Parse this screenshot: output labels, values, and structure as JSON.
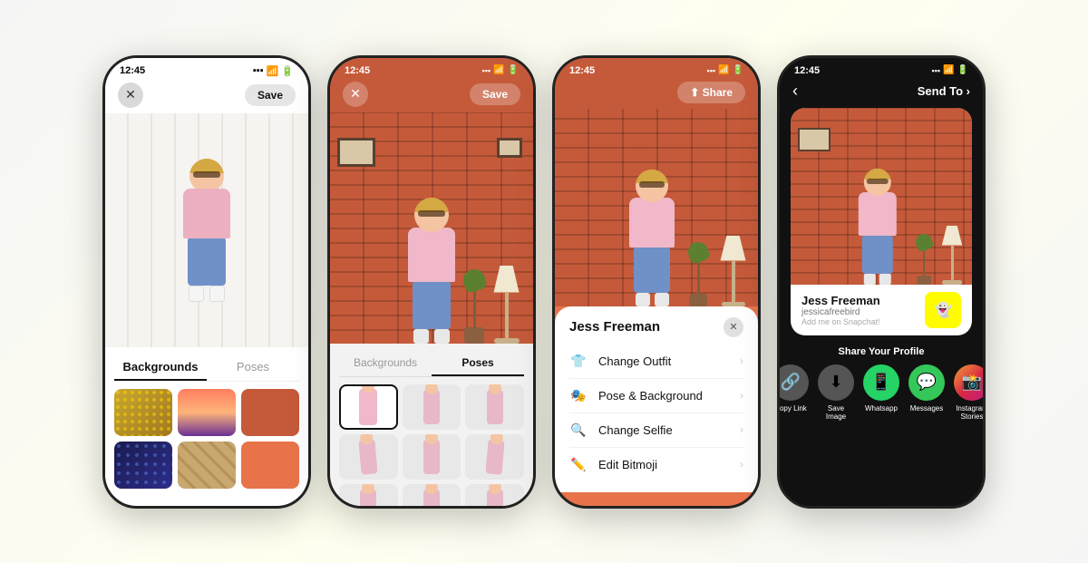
{
  "scene": {
    "bg_color": "#f0f0e8"
  },
  "phone1": {
    "status_time": "12:45",
    "close_label": "✕",
    "save_label": "Save",
    "tab_backgrounds": "Backgrounds",
    "tab_poses": "Poses",
    "active_tab": "backgrounds"
  },
  "phone2": {
    "status_time": "12:45",
    "close_label": "✕",
    "save_label": "Save",
    "tab_backgrounds": "Backgrounds",
    "tab_poses": "Poses",
    "active_tab": "poses"
  },
  "phone3": {
    "status_time": "12:45",
    "share_label": "⬆ Share",
    "user_name": "Jess Freeman",
    "close_label": "✕",
    "menu_items": [
      {
        "icon": "👕",
        "label": "Change Outfit"
      },
      {
        "icon": "🎭",
        "label": "Pose & Background"
      },
      {
        "icon": "🔍",
        "label": "Change Selfie"
      },
      {
        "icon": "✏️",
        "label": "Edit Bitmoji"
      }
    ]
  },
  "phone4": {
    "status_time": "12:45",
    "back_label": "‹",
    "send_to_label": "Send To ›",
    "user_name": "Jess Freeman",
    "user_handle": "jessicafreebird",
    "add_me_label": "Add me on Snapchat!",
    "share_section_label": "Share Your Profile",
    "share_options": [
      {
        "icon": "🔗",
        "label": "Copy Link",
        "bg": "#636363"
      },
      {
        "icon": "⬇",
        "label": "Save Image",
        "bg": "#636363"
      },
      {
        "icon": "📱",
        "label": "Whatsapp",
        "bg": "#25D366"
      },
      {
        "icon": "💬",
        "label": "Messages",
        "bg": "#34C759"
      },
      {
        "icon": "📸",
        "label": "Instagram Stories",
        "bg": "#E1306C"
      }
    ]
  }
}
